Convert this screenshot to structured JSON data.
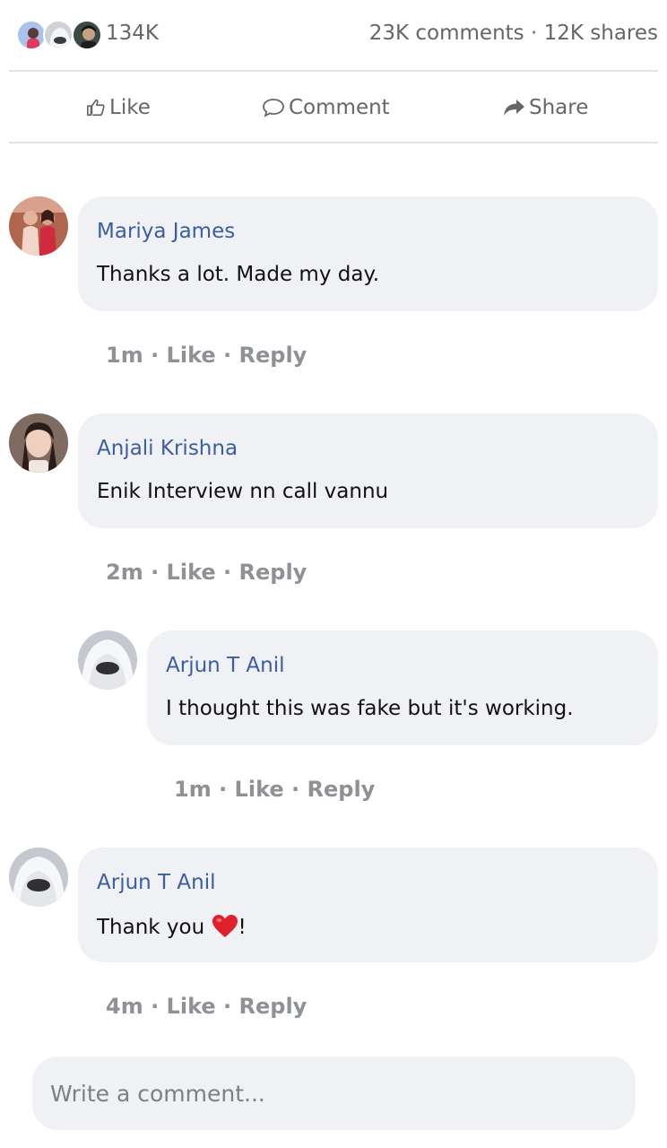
{
  "stats": {
    "reactions_count": "134K",
    "comments_shares": "23K comments · 12K shares"
  },
  "actions": {
    "like_label": "Like",
    "comment_label": "Comment",
    "share_label": "Share"
  },
  "comments": [
    {
      "author": "Mariya James",
      "text": "Thanks a lot. Made my day.",
      "time": "1m",
      "like": "Like",
      "reply": "Reply"
    },
    {
      "author": "Anjali Krishna",
      "text": "Enik Interview nn call vannu",
      "time": "2m",
      "like": "Like",
      "reply": "Reply"
    },
    {
      "author": "Arjun T Anil",
      "text": "I thought this was fake but it's working.",
      "time": "1m",
      "like": "Like",
      "reply": "Reply"
    },
    {
      "author": "Arjun T Anil",
      "text": "Thank you ",
      "text_suffix": "!",
      "time": "4m",
      "like": "Like",
      "reply": "Reply"
    }
  ],
  "composer": {
    "placeholder": "Write a comment..."
  },
  "colors": {
    "author": "#3c5da0",
    "bubble": "#f0f1f4",
    "muted": "#8e9196",
    "heart": "#e0202c"
  },
  "icons": {
    "like": "thumbs-up-icon",
    "comment": "speech-bubble-icon",
    "share": "share-arrow-icon",
    "heart": "heart-emoji-icon"
  }
}
